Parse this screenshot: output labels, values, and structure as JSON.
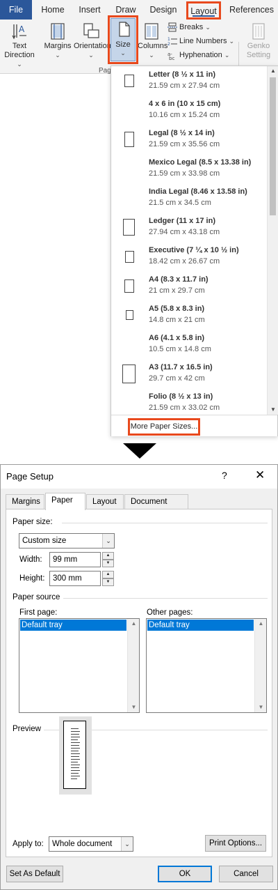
{
  "ribbon": {
    "tabs": [
      "File",
      "Home",
      "Insert",
      "Draw",
      "Design",
      "Layout",
      "References"
    ],
    "buttons": {
      "text_direction": [
        "Text",
        "Direction"
      ],
      "margins": "Margins",
      "orientation": "Orientation",
      "size": "Size",
      "columns": "Columns",
      "breaks": "Breaks",
      "line_numbers": "Line Numbers",
      "hyphenation": "Hyphenation",
      "genko": [
        "Genko",
        "Setting"
      ]
    },
    "group_label": "Page"
  },
  "size_menu": {
    "items": [
      {
        "name": "Letter (8 ½ x 11 in)",
        "dims": "21.59 cm x 27.94 cm"
      },
      {
        "name": "4 x 6 in (10 x 15 cm)",
        "dims": "10.16 cm x 15.24 cm"
      },
      {
        "name": "Legal (8 ½ x 14 in)",
        "dims": "21.59 cm x 35.56 cm"
      },
      {
        "name": "Mexico Legal (8.5 x 13.38 in)",
        "dims": "21.59 cm x 33.98 cm"
      },
      {
        "name": "India Legal (8.46 x 13.58 in)",
        "dims": "21.5 cm x 34.5 cm"
      },
      {
        "name": "Ledger (11 x 17 in)",
        "dims": "27.94 cm x 43.18 cm"
      },
      {
        "name": "Executive (7 ¼ x 10 ½ in)",
        "dims": "18.42 cm x 26.67 cm"
      },
      {
        "name": "A4 (8.3 x 11.7 in)",
        "dims": "21 cm x 29.7 cm"
      },
      {
        "name": "A5 (5.8 x 8.3 in)",
        "dims": "14.8 cm x 21 cm"
      },
      {
        "name": "A6 (4.1 x 5.8 in)",
        "dims": "10.5 cm x 14.8 cm"
      },
      {
        "name": "A3 (11.7 x 16.5 in)",
        "dims": "29.7 cm x 42 cm"
      },
      {
        "name": "Folio (8 ½ x 13 in)",
        "dims": "21.59 cm x 33.02 cm"
      }
    ],
    "more": "More Paper Sizes..."
  },
  "dialog": {
    "title": "Page Setup",
    "help": "?",
    "close": "✕",
    "tabs": [
      "Margins",
      "Paper",
      "Layout",
      "Document Grid"
    ],
    "active_tab": "Paper",
    "paper_size_label": "Paper size:",
    "paper_size_value": "Custom size",
    "width_label": "Width:",
    "width_value": "99 mm",
    "height_label": "Height:",
    "height_value": "300 mm",
    "paper_source_label": "Paper source",
    "first_page_label": "First page:",
    "first_page_selected": "Default tray",
    "other_pages_label": "Other pages:",
    "other_pages_selected": "Default tray",
    "preview_label": "Preview",
    "apply_to_label": "Apply to:",
    "apply_to_value": "Whole document",
    "print_options": "Print Options...",
    "set_as_default": "Set As Default",
    "ok": "OK",
    "cancel": "Cancel"
  },
  "colors": {
    "accent_highlight": "#e8491d",
    "file_tab": "#2b579a",
    "selection": "#0078d7"
  }
}
